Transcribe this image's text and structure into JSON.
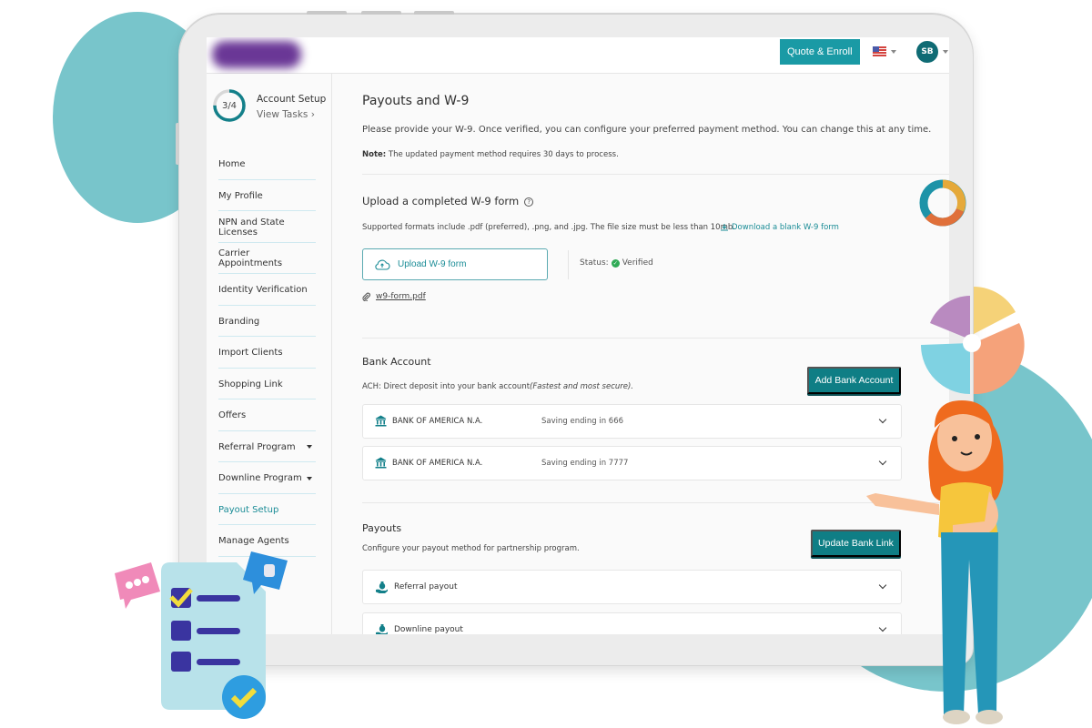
{
  "header": {
    "quote_button": "Quote & Enroll",
    "locale_icon": "us-flag-icon",
    "avatar_initials": "SB"
  },
  "sidebar": {
    "progress": {
      "completed": 3,
      "total": 4,
      "label": "3/4"
    },
    "setup_title": "Account Setup",
    "setup_link": "View Tasks ›",
    "items": [
      {
        "label": "Home",
        "has_dropdown": false,
        "active": false
      },
      {
        "label": "My Profile",
        "has_dropdown": false,
        "active": false
      },
      {
        "label": "NPN and State Licenses",
        "has_dropdown": false,
        "active": false
      },
      {
        "label": "Carrier Appointments",
        "has_dropdown": false,
        "active": false
      },
      {
        "label": "Identity Verification",
        "has_dropdown": false,
        "active": false
      },
      {
        "label": "Branding",
        "has_dropdown": false,
        "active": false
      },
      {
        "label": "Import Clients",
        "has_dropdown": false,
        "active": false
      },
      {
        "label": "Shopping Link",
        "has_dropdown": false,
        "active": false
      },
      {
        "label": "Offers",
        "has_dropdown": false,
        "active": false
      },
      {
        "label": "Referral Program",
        "has_dropdown": true,
        "active": false
      },
      {
        "label": "Downline Program",
        "has_dropdown": true,
        "active": false
      },
      {
        "label": "Payout Setup",
        "has_dropdown": false,
        "active": true
      },
      {
        "label": "Manage Agents",
        "has_dropdown": false,
        "active": false
      }
    ]
  },
  "main": {
    "title": "Payouts and W-9",
    "intro": "Please provide your W-9. Once verified, you can configure your preferred payment method. You can change this at any time.",
    "note_label": "Note:",
    "note_text": " The updated payment method requires 30 days to process.",
    "upload_section": {
      "title": "Upload a completed W-9 form",
      "help_icon": "?",
      "formats_text": "Supported formats include .pdf (preferred), .png, and .jpg. The file size must be less than 10mb.",
      "download_link": "Download a blank W-9 form",
      "upload_button": "Upload W-9 form",
      "status_label": "Status:",
      "status_value": "Verified",
      "file_name": "w9-form.pdf"
    },
    "bank_section": {
      "title": "Bank Account",
      "description_plain": "ACH: Direct deposit into your bank account",
      "description_italic": "(Fastest and most secure).",
      "add_button": "Add Bank Account",
      "accounts": [
        {
          "bank": "BANK OF AMERICA N.A.",
          "detail": "Saving ending in 666"
        },
        {
          "bank": "BANK OF AMERICA N.A.",
          "detail": "Saving ending in 7777"
        }
      ]
    },
    "payouts_section": {
      "title": "Payouts",
      "description": "Configure your payout method for partnership program.",
      "update_button": "Update Bank Link",
      "items": [
        {
          "label": "Referral payout"
        },
        {
          "label": "Downline payout"
        }
      ]
    }
  },
  "colors": {
    "accent": "#0f7e85",
    "link": "#1a8c96",
    "verified": "#2faa55",
    "background_circles": "#78c5cb"
  }
}
